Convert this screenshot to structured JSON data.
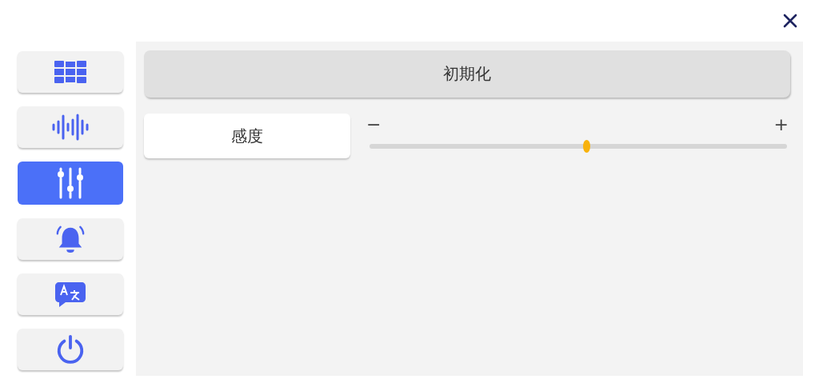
{
  "sidebar": {
    "items": [
      {
        "kind": "grid",
        "selected": false
      },
      {
        "kind": "wave",
        "selected": false
      },
      {
        "kind": "sliders",
        "selected": true
      },
      {
        "kind": "bell",
        "selected": false
      },
      {
        "kind": "translate",
        "selected": false
      },
      {
        "kind": "power",
        "selected": false
      }
    ]
  },
  "reset_button": "初期化",
  "sensitivity": {
    "label": "感度",
    "minus": "−",
    "plus": "+",
    "level": 0.52
  }
}
